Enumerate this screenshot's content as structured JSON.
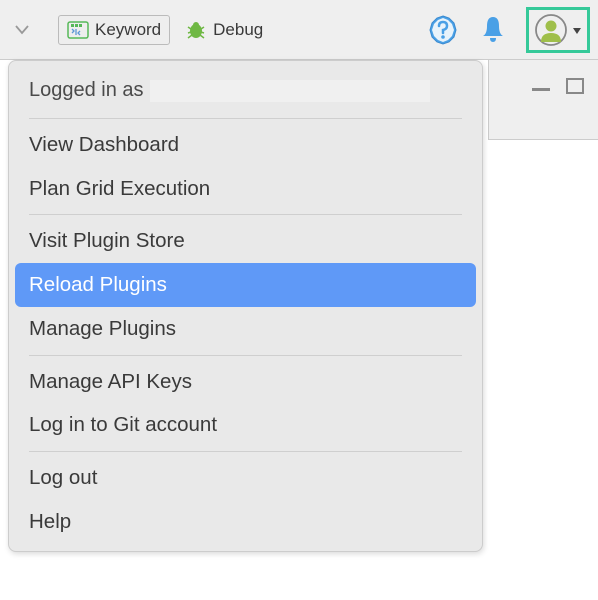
{
  "toolbar": {
    "keyword_label": "Keyword",
    "debug_label": "Debug"
  },
  "menu": {
    "logged_in_as": "Logged in as",
    "username": "",
    "groups": [
      [
        "View Dashboard",
        "Plan Grid Execution"
      ],
      [
        "Visit Plugin Store",
        "Reload Plugins",
        "Manage Plugins"
      ],
      [
        "Manage API Keys",
        "Log in to Git account"
      ],
      [
        "Log out",
        "Help"
      ]
    ],
    "highlighted": "Reload Plugins"
  }
}
